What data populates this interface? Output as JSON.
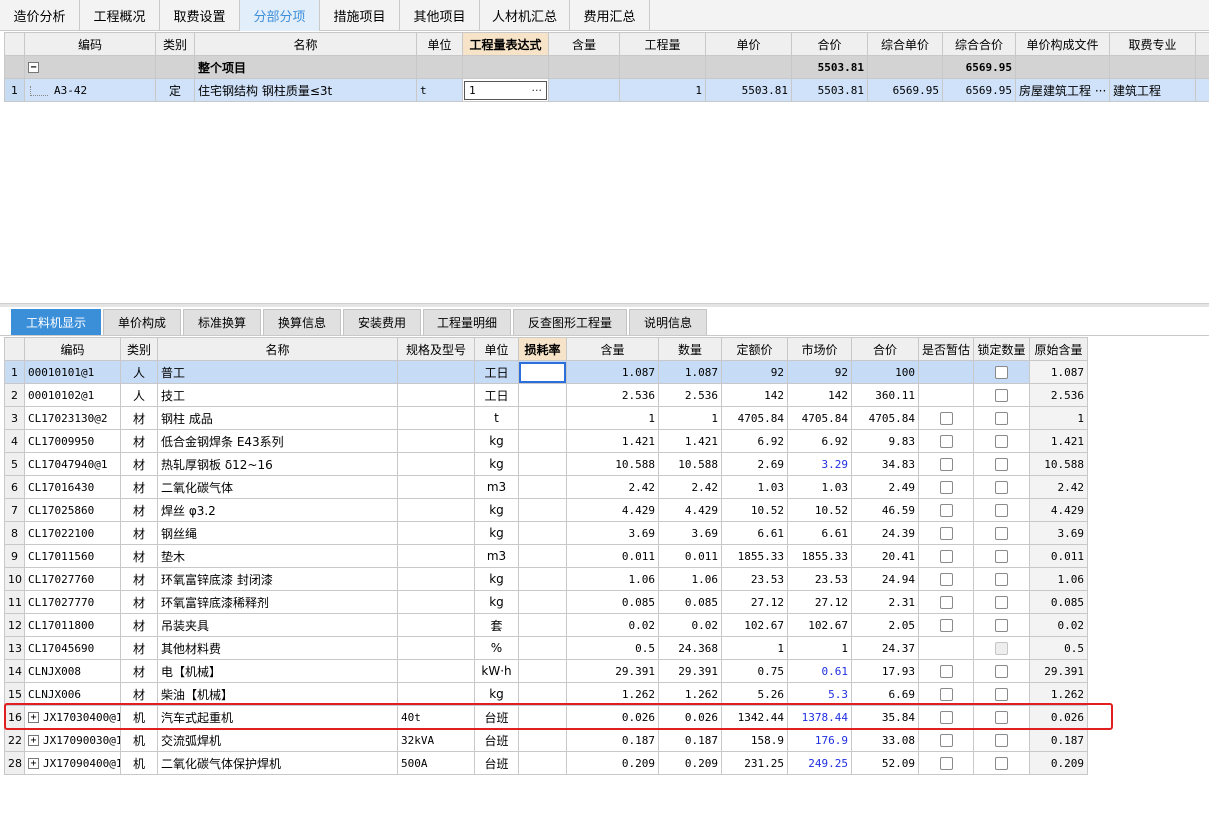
{
  "top_tabs": [
    "造价分析",
    "工程概况",
    "取费设置",
    "分部分项",
    "措施项目",
    "其他项目",
    "人材机汇总",
    "费用汇总"
  ],
  "upper_grid": {
    "headers": [
      "编码",
      "类别",
      "名称",
      "单位",
      "工程量表达式",
      "含量",
      "工程量",
      "单价",
      "合价",
      "综合单价",
      "综合合价",
      "单价构成文件",
      "取费专业"
    ],
    "group_row": {
      "toggle": "−",
      "name": "整个项目",
      "total": "5503.81",
      "composite_total": "6569.95"
    },
    "item_row": {
      "no": "1",
      "code": "A3-42",
      "category": "定",
      "name": "住宅钢结构 钢柱质量≤3t",
      "unit": "t",
      "expression": "1",
      "expression_btn": "···",
      "content": "",
      "quantity": "1",
      "unit_price": "5503.81",
      "total": "5503.81",
      "composite_unit_price": "6569.95",
      "composite_total": "6569.95",
      "price_file": "房屋建筑工程",
      "price_file_btn": "···",
      "fee_major": "建筑工程"
    }
  },
  "bottom_tabs": [
    "工料机显示",
    "单价构成",
    "标准换算",
    "换算信息",
    "安装费用",
    "工程量明细",
    "反查图形工程量",
    "说明信息"
  ],
  "lower_grid": {
    "headers": [
      "编码",
      "类别",
      "名称",
      "规格及型号",
      "单位",
      "损耗率",
      "含量",
      "数量",
      "定额价",
      "市场价",
      "合价",
      "是否暂估",
      "锁定数量",
      "原始含量"
    ],
    "rows": [
      {
        "no": "1",
        "code": "00010101@1",
        "cat": "人",
        "name": "普工",
        "spec": "",
        "unit": "工日",
        "loss": "",
        "content": "1.087",
        "qty": "1.087",
        "quota": "92",
        "market": "92",
        "total": "100",
        "orig": "1.087"
      },
      {
        "no": "2",
        "code": "00010102@1",
        "cat": "人",
        "name": "技工",
        "spec": "",
        "unit": "工日",
        "loss": "",
        "content": "2.536",
        "qty": "2.536",
        "quota": "142",
        "market": "142",
        "total": "360.11",
        "orig": "2.536"
      },
      {
        "no": "3",
        "code": "CL17023130@2",
        "cat": "材",
        "name": "钢柱 成品",
        "spec": "",
        "unit": "t",
        "loss": "",
        "content": "1",
        "qty": "1",
        "quota": "4705.84",
        "market": "4705.84",
        "total": "4705.84",
        "orig": "1"
      },
      {
        "no": "4",
        "code": "CL17009950",
        "cat": "材",
        "name": "低合金钢焊条 E43系列",
        "spec": "",
        "unit": "kg",
        "loss": "",
        "content": "1.421",
        "qty": "1.421",
        "quota": "6.92",
        "market": "6.92",
        "total": "9.83",
        "orig": "1.421"
      },
      {
        "no": "5",
        "code": "CL17047940@1",
        "cat": "材",
        "name": "热轧厚钢板 δ12~16",
        "spec": "",
        "unit": "kg",
        "loss": "",
        "content": "10.588",
        "qty": "10.588",
        "quota": "2.69",
        "market": "3.29",
        "total": "34.83",
        "orig": "10.588"
      },
      {
        "no": "6",
        "code": "CL17016430",
        "cat": "材",
        "name": "二氧化碳气体",
        "spec": "",
        "unit": "m3",
        "loss": "",
        "content": "2.42",
        "qty": "2.42",
        "quota": "1.03",
        "market": "1.03",
        "total": "2.49",
        "orig": "2.42"
      },
      {
        "no": "7",
        "code": "CL17025860",
        "cat": "材",
        "name": "焊丝 φ3.2",
        "spec": "",
        "unit": "kg",
        "loss": "",
        "content": "4.429",
        "qty": "4.429",
        "quota": "10.52",
        "market": "10.52",
        "total": "46.59",
        "orig": "4.429"
      },
      {
        "no": "8",
        "code": "CL17022100",
        "cat": "材",
        "name": "钢丝绳",
        "spec": "",
        "unit": "kg",
        "loss": "",
        "content": "3.69",
        "qty": "3.69",
        "quota": "6.61",
        "market": "6.61",
        "total": "24.39",
        "orig": "3.69"
      },
      {
        "no": "9",
        "code": "CL17011560",
        "cat": "材",
        "name": "垫木",
        "spec": "",
        "unit": "m3",
        "loss": "",
        "content": "0.011",
        "qty": "0.011",
        "quota": "1855.33",
        "market": "1855.33",
        "total": "20.41",
        "orig": "0.011"
      },
      {
        "no": "10",
        "code": "CL17027760",
        "cat": "材",
        "name": "环氧富锌底漆 封闭漆",
        "spec": "",
        "unit": "kg",
        "loss": "",
        "content": "1.06",
        "qty": "1.06",
        "quota": "23.53",
        "market": "23.53",
        "total": "24.94",
        "orig": "1.06"
      },
      {
        "no": "11",
        "code": "CL17027770",
        "cat": "材",
        "name": "环氧富锌底漆稀释剂",
        "spec": "",
        "unit": "kg",
        "loss": "",
        "content": "0.085",
        "qty": "0.085",
        "quota": "27.12",
        "market": "27.12",
        "total": "2.31",
        "orig": "0.085"
      },
      {
        "no": "12",
        "code": "CL17011800",
        "cat": "材",
        "name": "吊装夹具",
        "spec": "",
        "unit": "套",
        "loss": "",
        "content": "0.02",
        "qty": "0.02",
        "quota": "102.67",
        "market": "102.67",
        "total": "2.05",
        "orig": "0.02"
      },
      {
        "no": "13",
        "code": "CL17045690",
        "cat": "材",
        "name": "其他材料费",
        "spec": "",
        "unit": "%",
        "loss": "",
        "content": "0.5",
        "qty": "24.368",
        "quota": "1",
        "market": "1",
        "total": "24.37",
        "orig": "0.5"
      },
      {
        "no": "14",
        "code": "CLNJX008",
        "cat": "材",
        "name": "电【机械】",
        "spec": "",
        "unit": "kW·h",
        "loss": "",
        "content": "29.391",
        "qty": "29.391",
        "quota": "0.75",
        "market": "0.61",
        "total": "17.93",
        "orig": "29.391"
      },
      {
        "no": "15",
        "code": "CLNJX006",
        "cat": "材",
        "name": "柴油【机械】",
        "spec": "",
        "unit": "kg",
        "loss": "",
        "content": "1.262",
        "qty": "1.262",
        "quota": "5.26",
        "market": "5.3",
        "total": "6.69",
        "orig": "1.262"
      },
      {
        "no": "16",
        "code": "JX17030400@1",
        "cat": "机",
        "name": "汽车式起重机",
        "spec": "40t",
        "unit": "台班",
        "loss": "",
        "content": "0.026",
        "qty": "0.026",
        "quota": "1342.44",
        "market": "1378.44",
        "total": "35.84",
        "orig": "0.026"
      },
      {
        "no": "22",
        "code": "JX17090030@1",
        "cat": "机",
        "name": "交流弧焊机",
        "spec": "32kVA",
        "unit": "台班",
        "loss": "",
        "content": "0.187",
        "qty": "0.187",
        "quota": "158.9",
        "market": "176.9",
        "total": "33.08",
        "orig": "0.187"
      },
      {
        "no": "28",
        "code": "JX17090400@1",
        "cat": "机",
        "name": "二氧化碳气体保护焊机",
        "spec": "500A",
        "unit": "台班",
        "loss": "",
        "content": "0.209",
        "qty": "0.209",
        "quota": "231.25",
        "market": "249.25",
        "total": "52.09",
        "orig": "0.209"
      }
    ]
  },
  "tree_toggle_plus": "+"
}
